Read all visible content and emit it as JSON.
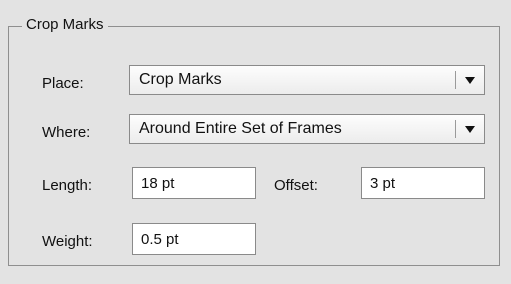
{
  "group": {
    "title": "Crop Marks"
  },
  "place": {
    "label": "Place:",
    "value": "Crop Marks"
  },
  "where": {
    "label": "Where:",
    "value": "Around Entire Set of Frames"
  },
  "length": {
    "label": "Length:",
    "value": "18 pt"
  },
  "offset": {
    "label": "Offset:",
    "value": "3 pt"
  },
  "weight": {
    "label": "Weight:",
    "value": "0.5 pt"
  },
  "icons": {
    "dropdown": "chevron-down-icon"
  }
}
